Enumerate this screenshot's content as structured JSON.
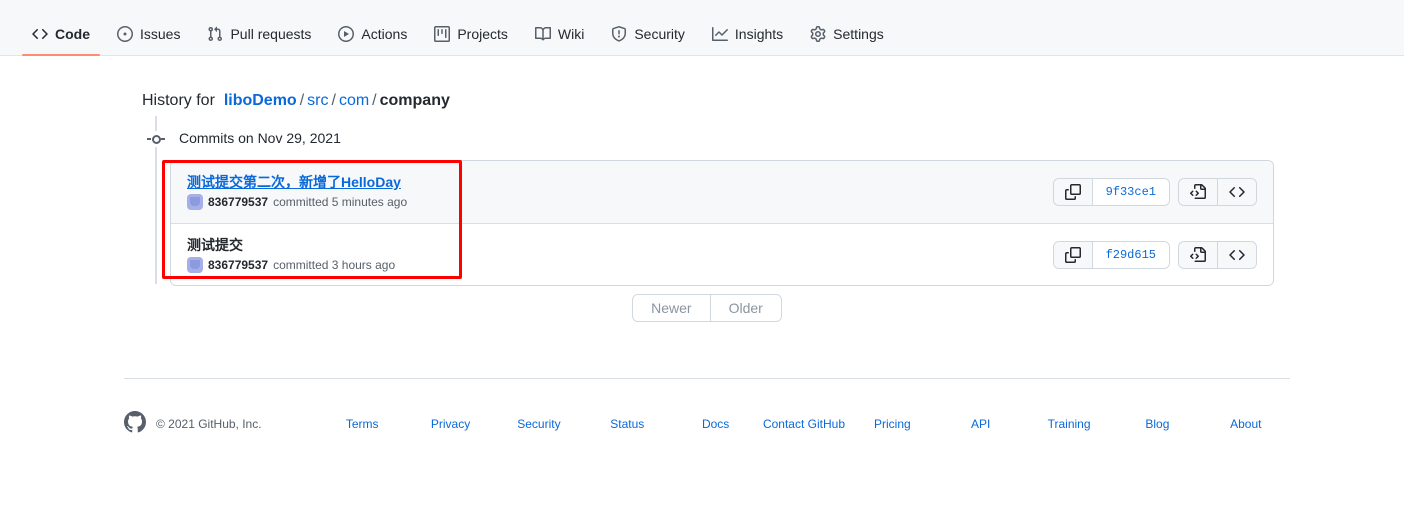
{
  "repo_nav": {
    "items": [
      {
        "label": "Code",
        "icon": "code-icon",
        "selected": true
      },
      {
        "label": "Issues",
        "icon": "issue-opened-icon",
        "selected": false
      },
      {
        "label": "Pull requests",
        "icon": "git-pull-request-icon",
        "selected": false
      },
      {
        "label": "Actions",
        "icon": "play-icon",
        "selected": false
      },
      {
        "label": "Projects",
        "icon": "project-icon",
        "selected": false
      },
      {
        "label": "Wiki",
        "icon": "book-icon",
        "selected": false
      },
      {
        "label": "Security",
        "icon": "shield-icon",
        "selected": false
      },
      {
        "label": "Insights",
        "icon": "graph-icon",
        "selected": false
      },
      {
        "label": "Settings",
        "icon": "gear-icon",
        "selected": false
      }
    ]
  },
  "breadcrumb": {
    "prefix": "History for",
    "repo": "liboDemo",
    "segments": [
      "src",
      "com"
    ],
    "current": "company",
    "separator": "/"
  },
  "timeline": {
    "commits_header": "Commits on Nov 29, 2021",
    "marker_icon": "commit-dot-icon"
  },
  "commits": [
    {
      "title": "测试提交第二次，新增了HelloDay",
      "title_is_link": true,
      "row_hovered": true,
      "author": "836779537",
      "committed_text": "committed 5 minutes ago",
      "sha": "9f33ce1",
      "copy_icon": "copy-icon",
      "browse_icon": "file-code-icon",
      "code_icon": "code-icon",
      "avatar_icon": "avatar"
    },
    {
      "title": "测试提交",
      "title_is_link": false,
      "row_hovered": false,
      "author": "836779537",
      "committed_text": "committed 3 hours ago",
      "sha": "f29d615",
      "copy_icon": "copy-icon",
      "browse_icon": "file-code-icon",
      "code_icon": "code-icon",
      "avatar_icon": "avatar"
    }
  ],
  "pagination": {
    "newer": "Newer",
    "older": "Older",
    "newer_enabled": false,
    "older_enabled": false
  },
  "footer": {
    "logo_icon": "github-mark-icon",
    "copyright": "© 2021 GitHub, Inc.",
    "links": [
      "Terms",
      "Privacy",
      "Security",
      "Status",
      "Docs",
      "Contact GitHub",
      "Pricing",
      "API",
      "Training",
      "Blog",
      "About"
    ]
  },
  "annotation": {
    "highlight_color": "#fe0000",
    "shape": "rectangle"
  },
  "colors": {
    "accent_blue": "#0969da",
    "nav_active_underline": "#fd8c73",
    "header_bg": "#f6f8fa",
    "border": "#d0d7de",
    "text": "#24292f",
    "muted_text": "#57606a"
  }
}
